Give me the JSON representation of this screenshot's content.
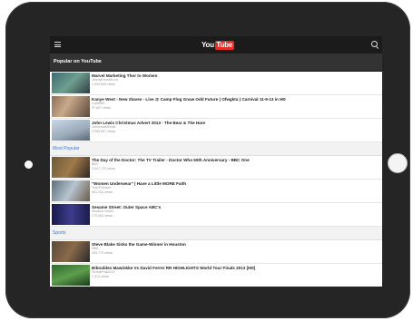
{
  "app": {
    "logo_you": "You",
    "logo_tube": "Tube"
  },
  "header": {
    "title": "Popular on YouTube"
  },
  "top_videos": [
    {
      "title": "Marvel Marketing Thor to Women",
      "sub1": "JimmyKimmelLive",
      "sub2": "1,009,655 views"
    },
    {
      "title": "Kanye West - New Slaves - Live @ Camp Flog Gnaw Odd Future ( Ofwgkta ) Carnival 11-9-13 in HD",
      "sub1": "LupeMM",
      "sub2": "97,807 views"
    },
    {
      "title": "John Lewis Christmas Advert 2013 - The Bear & The Hare",
      "sub1": "JohnLewisRetail",
      "sub2": "3,095,667 views"
    }
  ],
  "sections": [
    {
      "label": "Most Popular",
      "videos": [
        {
          "title": "The Day of the Doctor: The TV Trailer - Doctor Who 50th Anniversary - BBC One",
          "sub1": "BBC",
          "sub2": "3,347,723 views"
        },
        {
          "title": "\"Women Underwear\" | Have a Little MORE Faith",
          "sub1": "Tory/Fonoker",
          "sub2": "861,334 views"
        },
        {
          "title": "Sesame Street: Outer Space ABC's",
          "sub1": "Sesame Street",
          "sub2": "279,905 views"
        }
      ]
    },
    {
      "label": "Sports",
      "videos": [
        {
          "title": "Steve Blake Sinks the Game-Winner in Houston",
          "sub1": "NBA",
          "sub2": "283,779 views"
        },
        {
          "title": "Bibnoldes Mawinkke Vs David Ferrer RR HIGHLIGHTS World Tour Finals 2013 [HD]",
          "sub1": "TennisPlus2013",
          "sub2": "1,313 views"
        }
      ]
    }
  ]
}
